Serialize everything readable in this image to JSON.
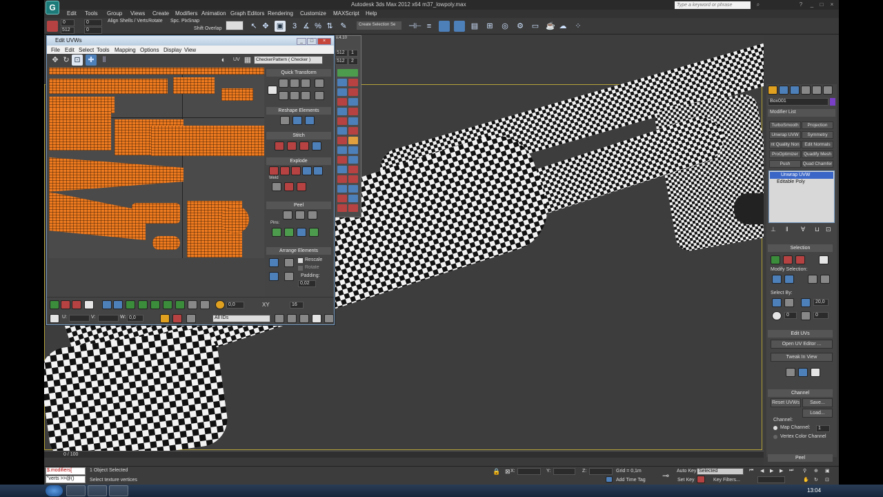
{
  "app": {
    "title": "Autodesk 3ds Max  2012 x64     m37_lowpoly.max",
    "search_placeholder": "Type a keyword or phrase",
    "logo_letter": "G"
  },
  "menu": [
    "Edit",
    "Tools",
    "Group",
    "Views",
    "Create",
    "Modifiers",
    "Animation",
    "Graph Editors",
    "Rendering",
    "Customize",
    "MAXScript",
    "Help"
  ],
  "toolbar": {
    "tools_labels": [
      "Align Shells / Verts",
      "Rotate",
      "Spc. PixSnap"
    ],
    "shift_overlap": "Shift Overlap",
    "selection_set": "Create Selection Se",
    "num_fields": [
      "0",
      "0",
      "512",
      "0"
    ]
  },
  "uvw_editor": {
    "title": "Edit UVWs",
    "menu": [
      "File",
      "Edit",
      "Select",
      "Tools",
      "Mapping",
      "Options",
      "Display",
      "View"
    ],
    "uv_label": "UV",
    "checker": "CheckerPattern  ( Checker )",
    "rollouts": {
      "quick_transform": "Quick Transform",
      "reshape": "Reshape Elements",
      "stitch": "Stitch",
      "explode": "Explode",
      "weld": "Weld",
      "peel": "Peel",
      "pins": "Pins:",
      "arrange": "Arrange Elements",
      "rescale": "Rescale",
      "rotate": "Rotate",
      "padding_label": "Padding:",
      "padding_value": "0,02"
    },
    "bottom": {
      "value1": "0,0",
      "xy": "XY",
      "value2": "16",
      "u_label": "U:",
      "v_label": "V:",
      "w_label": "W:",
      "w_value": "0,0",
      "ids": "All IDs"
    }
  },
  "floating_toolbar": {
    "version": "v.4.10",
    "fields": [
      "512",
      "1",
      "512",
      "2"
    ]
  },
  "command_panel": {
    "object_name": "Box001",
    "modifier_list": "Modifier List",
    "modifier_buttons": [
      "TurboSmooth",
      "Projection",
      "Unwrap UVW",
      "Symmetry",
      "nt Quality Non",
      "Edit Normals",
      "ProOptimizer",
      "Quadify Mesh",
      "Push",
      "Quad Chamfer"
    ],
    "stack": [
      "Unwrap UVW",
      "Editable Poly"
    ],
    "selection_header": "Selection",
    "modify_selection": "Modify Selection:",
    "select_by": "Select By:",
    "angle_value": "20,0",
    "zero1": "0",
    "zero2": "0",
    "edit_uvs_header": "Edit UVs",
    "open_uv_editor": "Open UV Editor ...",
    "tweak_in_view": "Tweak In View",
    "channel_header": "Channel",
    "reset_uvws": "Reset UVWs",
    "save": "Save...",
    "load": "Load...",
    "channel_label": "Channel:",
    "map_channel": "Map Channel:",
    "map_channel_value": "1",
    "vertex_color_channel": "Vertex Color Channel",
    "peel_header": "Peel"
  },
  "timeline": {
    "frame": "0 / 100"
  },
  "status": {
    "maxscript1": "$.modifiers[",
    "maxscript2": "\"verts >>@()",
    "objects_selected": "1 Object Selected",
    "prompt": "Select texture vertices",
    "x_label": "X:",
    "y_label": "Y:",
    "z_label": "Z:",
    "grid": "Grid = 0,1m",
    "add_time_tag": "Add Time Tag",
    "auto_key": "Auto Key",
    "selected": "Selected",
    "set_key": "Set Key",
    "key_filters": "Key Filters..."
  },
  "taskbar": {
    "clock": "13:04"
  },
  "colors": {
    "uv_shell": "#ee7a1f",
    "viewport_bg": "#3d3d3d",
    "active_border": "#b6a33a",
    "stack_highlight": "#3a66c7"
  }
}
